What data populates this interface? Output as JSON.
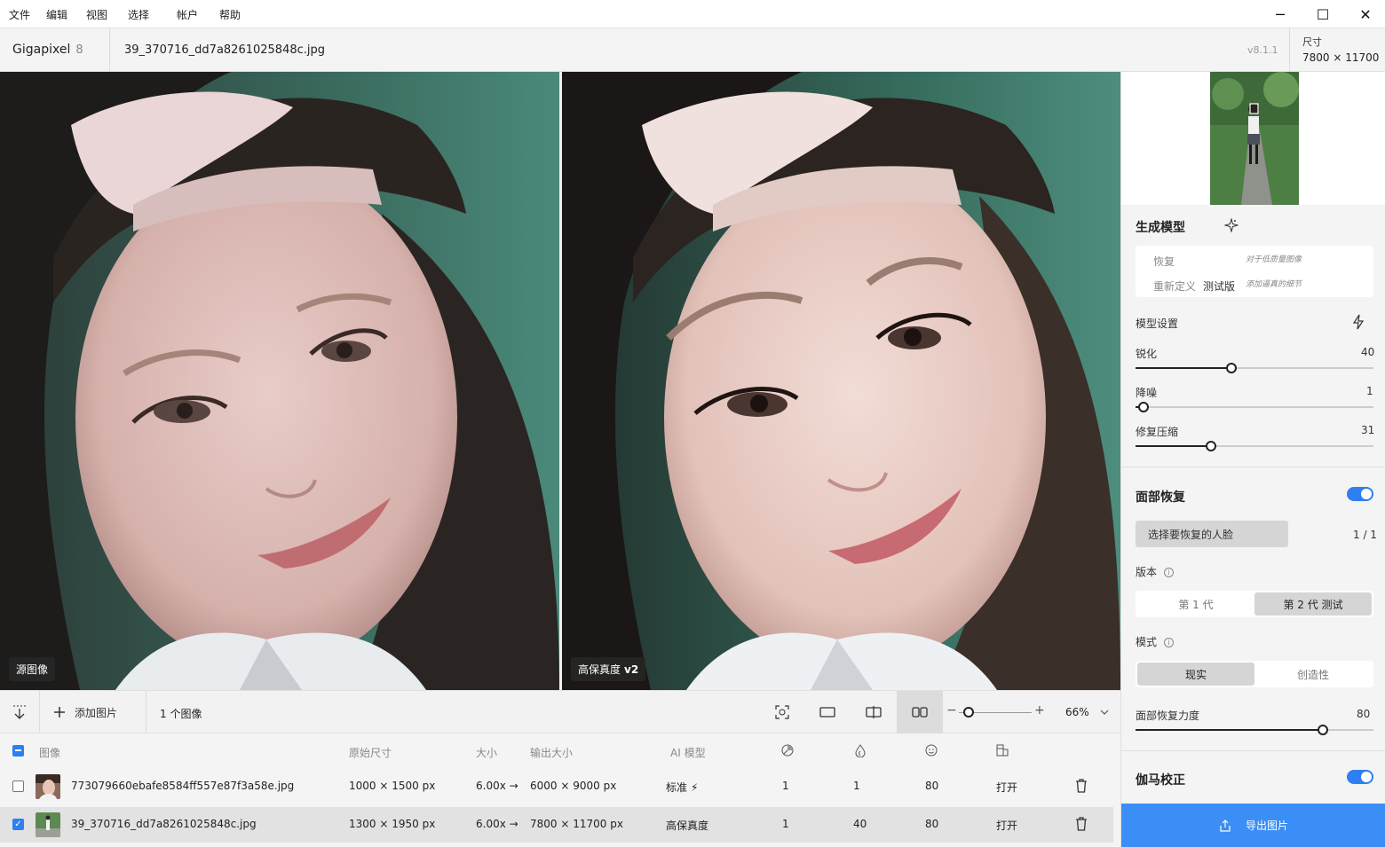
{
  "menu": {
    "file": "文件",
    "edit": "编辑",
    "view": "视图",
    "select": "选择",
    "account": "帐户",
    "help": "帮助"
  },
  "window_controls": {
    "minimize": "─",
    "maximize": "☐",
    "close": "✕"
  },
  "header": {
    "app_name": "Gigapixel",
    "app_count": "8",
    "file_name": "39_370716_dd7a8261025848c.jpg",
    "version": "v8.1.1",
    "dimension_label": "尺寸",
    "dimension_value": "7800 × 11700"
  },
  "preview": {
    "left_label": "源图像",
    "right_label": "高保真度",
    "right_label_version": "v2"
  },
  "toolbar": {
    "add_image": "添加图片",
    "image_count": "1 个图像",
    "zoom_level": "66%",
    "zoom_minus": "−",
    "zoom_plus": "+"
  },
  "table": {
    "headers": {
      "image": "图像",
      "original_size": "原始尺寸",
      "scale": "大小",
      "output_size": "输出大小",
      "ai_model": "AI 模型"
    },
    "rows": [
      {
        "name": "773079660ebafe8584ff557e87f3a58e.jpg",
        "original": "1000 × 1500 px",
        "scale": "6.00x →",
        "output": "6000 × 9000 px",
        "model": "标准",
        "sharpen": "1",
        "denoise": "1",
        "face": "80",
        "open": "打开",
        "checked": false
      },
      {
        "name": "39_370716_dd7a8261025848c.jpg",
        "original": "1300 × 1950 px",
        "scale": "6.00x →",
        "output": "7800 × 11700 px",
        "model": "高保真度",
        "sharpen": "1",
        "denoise": "40",
        "face": "80",
        "open": "打开",
        "checked": true
      }
    ]
  },
  "panel": {
    "gen_model": {
      "title": "生成模型",
      "recover_label": "恢复",
      "recover_desc": "对于低质量图像",
      "redefine_label": "重新定义",
      "redefine_badge": "测试版",
      "redefine_desc": "添加逼真的细节"
    },
    "model_settings": {
      "title": "模型设置",
      "sliders": [
        {
          "label": "锐化",
          "value": 40,
          "max": 100
        },
        {
          "label": "降噪",
          "value": 1,
          "max": 100
        },
        {
          "label": "修复压缩",
          "value": 31,
          "max": 100
        }
      ]
    },
    "face_recovery": {
      "title": "面部恢复",
      "enabled": true,
      "select_button": "选择要恢复的人脸",
      "face_count": "1 / 1",
      "version_label": "版本",
      "versions": [
        "第 1 代",
        "第 2 代   测试"
      ],
      "version_active": 1,
      "mode_label": "模式",
      "modes": [
        "现实",
        "创造性"
      ],
      "mode_active": 0,
      "strength_label": "面部恢复力度",
      "strength_value": 80
    },
    "gamma": {
      "title": "伽马校正",
      "enabled": true
    },
    "export_label": "导出图片"
  },
  "colors": {
    "accent": "#3a8ef6",
    "toggle": "#2f7ff0"
  }
}
